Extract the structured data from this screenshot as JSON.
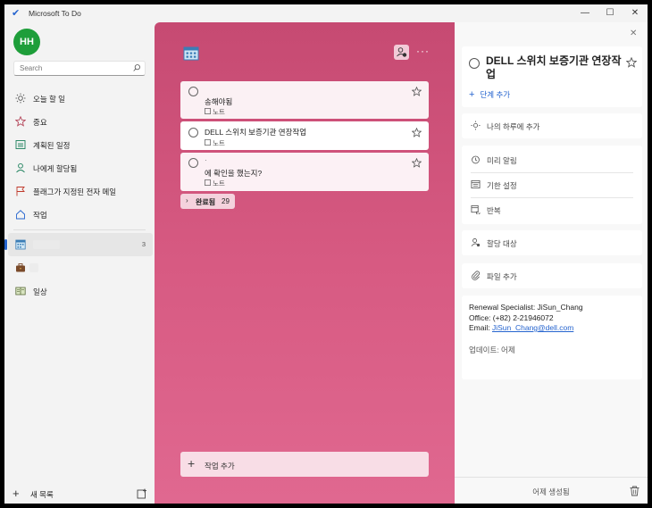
{
  "window": {
    "title": "Microsoft To Do",
    "minimize": "—",
    "maximize": "☐",
    "close": "✕"
  },
  "sidebar": {
    "avatar_initials": "HH",
    "search_placeholder": "Search",
    "smart_lists": [
      {
        "label": "오늘 할 일",
        "icon": "sun-icon"
      },
      {
        "label": "중요",
        "icon": "star-icon"
      },
      {
        "label": "계획된 일정",
        "icon": "calendar-grid-icon"
      },
      {
        "label": "나에게 할당됨",
        "icon": "person-icon"
      },
      {
        "label": "플래그가 지정된 전자 메일",
        "icon": "flag-icon"
      },
      {
        "label": "작업",
        "icon": "home-icon"
      }
    ],
    "lists": [
      {
        "label": "",
        "badge": "3",
        "icon": "list-calendar-icon",
        "active": true
      },
      {
        "label": "",
        "icon": "briefcase-icon"
      },
      {
        "label": "일상",
        "icon": "notebook-icon"
      }
    ],
    "new_list_label": "새 목록"
  },
  "main": {
    "tasks": [
      {
        "title": "송해야됨",
        "note": "노트",
        "prefix": ""
      },
      {
        "title": "DELL 스위치 보증기관 연장작업",
        "note": "노트",
        "prefix": ""
      },
      {
        "title": "에 확인을 했는지?",
        "note": "노트",
        "prefix": "·"
      }
    ],
    "completed_label": "완료됨",
    "completed_count": "29",
    "add_task_label": "작업 추가"
  },
  "detail": {
    "task_title": "DELL 스위치 보증기관 연장작업",
    "add_step_label": "단계 추가",
    "my_day_label": "나의 하루에 추가",
    "remind_label": "미리 알림",
    "due_label": "기한 설정",
    "repeat_label": "반복",
    "assign_label": "할당 대상",
    "file_label": "파일 추가",
    "note": {
      "line1": "Renewal Specialist: JiSun_Chang",
      "line2": "Office: (+82) 2-21946072",
      "email_prefix": "Email: ",
      "email": "JiSun_Chang@dell.com"
    },
    "updated_label": "업데이트: 어제",
    "created_label": "어제 생성됨"
  },
  "colors": {
    "accent": "#2564cf",
    "list_theme": "#d75a82",
    "avatar": "#1e9e3a"
  }
}
